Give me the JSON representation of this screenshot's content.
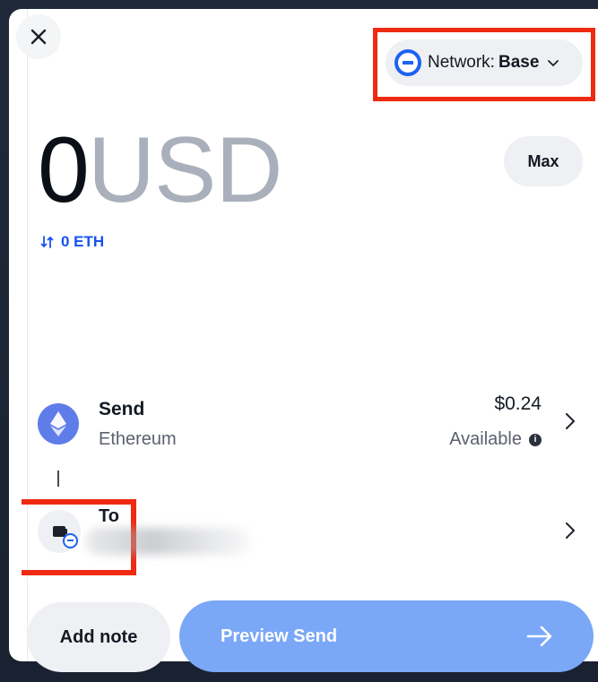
{
  "header": {
    "close_icon": "close-icon",
    "network": {
      "label": "Network:",
      "value": "Base",
      "icon": "base-network-icon"
    }
  },
  "amount": {
    "value": "0",
    "currency": "USD"
  },
  "max_label": "Max",
  "conversion": {
    "icon": "swap-arrows-icon",
    "text": "0 ETH"
  },
  "send": {
    "title": "Send",
    "asset": "Ethereum",
    "amount": "$0.24",
    "available": "Available",
    "icon": "ethereum-icon"
  },
  "to": {
    "label": "To",
    "icon": "wallet-icon",
    "address_redacted": true
  },
  "actions": {
    "add_note": "Add note",
    "preview_send": "Preview Send"
  },
  "colors": {
    "accent": "#1652f0",
    "highlight": "#ee2a12",
    "preview_button": "#7aa7f6"
  }
}
